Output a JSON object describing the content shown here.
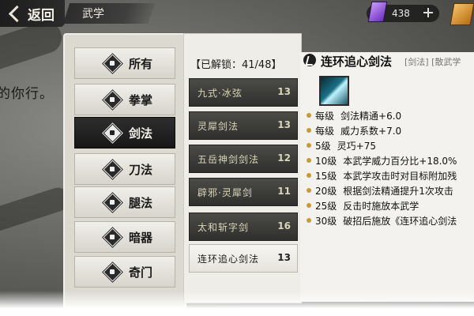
{
  "header": {
    "back_label": "返回",
    "title": "武学",
    "currency_value": "438"
  },
  "left_hint": "的你行。",
  "categories": [
    {
      "label": "所有",
      "active": false
    },
    {
      "label": "拳掌",
      "active": false
    },
    {
      "label": "剑法",
      "active": true
    },
    {
      "label": "刀法",
      "active": false
    },
    {
      "label": "腿法",
      "active": false
    },
    {
      "label": "暗器",
      "active": false
    },
    {
      "label": "奇门",
      "active": false
    }
  ],
  "skills_list": {
    "unlock_header": "【已解锁：41/48】",
    "items": [
      {
        "name": "九式·冰弦",
        "level": "13",
        "active": false
      },
      {
        "name": "灵犀剑法",
        "level": "13",
        "active": false
      },
      {
        "name": "五岳神剑剑法",
        "level": "12",
        "active": false
      },
      {
        "name": "辟邪·灵犀剑",
        "level": "11",
        "active": false
      },
      {
        "name": "太和斩字剑",
        "level": "16",
        "active": false
      },
      {
        "name": "连环追心剑法",
        "level": "13",
        "active": true
      }
    ]
  },
  "detail": {
    "title": "连环追心剑法",
    "tags": "[剑法] [散武学",
    "effects": [
      {
        "level": "每级",
        "text": "剑法精通+6.0"
      },
      {
        "level": "每级",
        "text": "威力系数+7.0"
      },
      {
        "level": "5级",
        "text": "灵巧+75"
      },
      {
        "level": "10级",
        "text": "本武学威力百分比+18.0%"
      },
      {
        "level": "15级",
        "text": "本武学攻击时对目标附加残"
      },
      {
        "level": "20级",
        "text": "根据剑法精通提升1次攻击"
      },
      {
        "level": "25级",
        "text": "反击时施放本武学"
      },
      {
        "level": "30级",
        "text": "破招后施放《连环追心剑法"
      }
    ]
  }
}
